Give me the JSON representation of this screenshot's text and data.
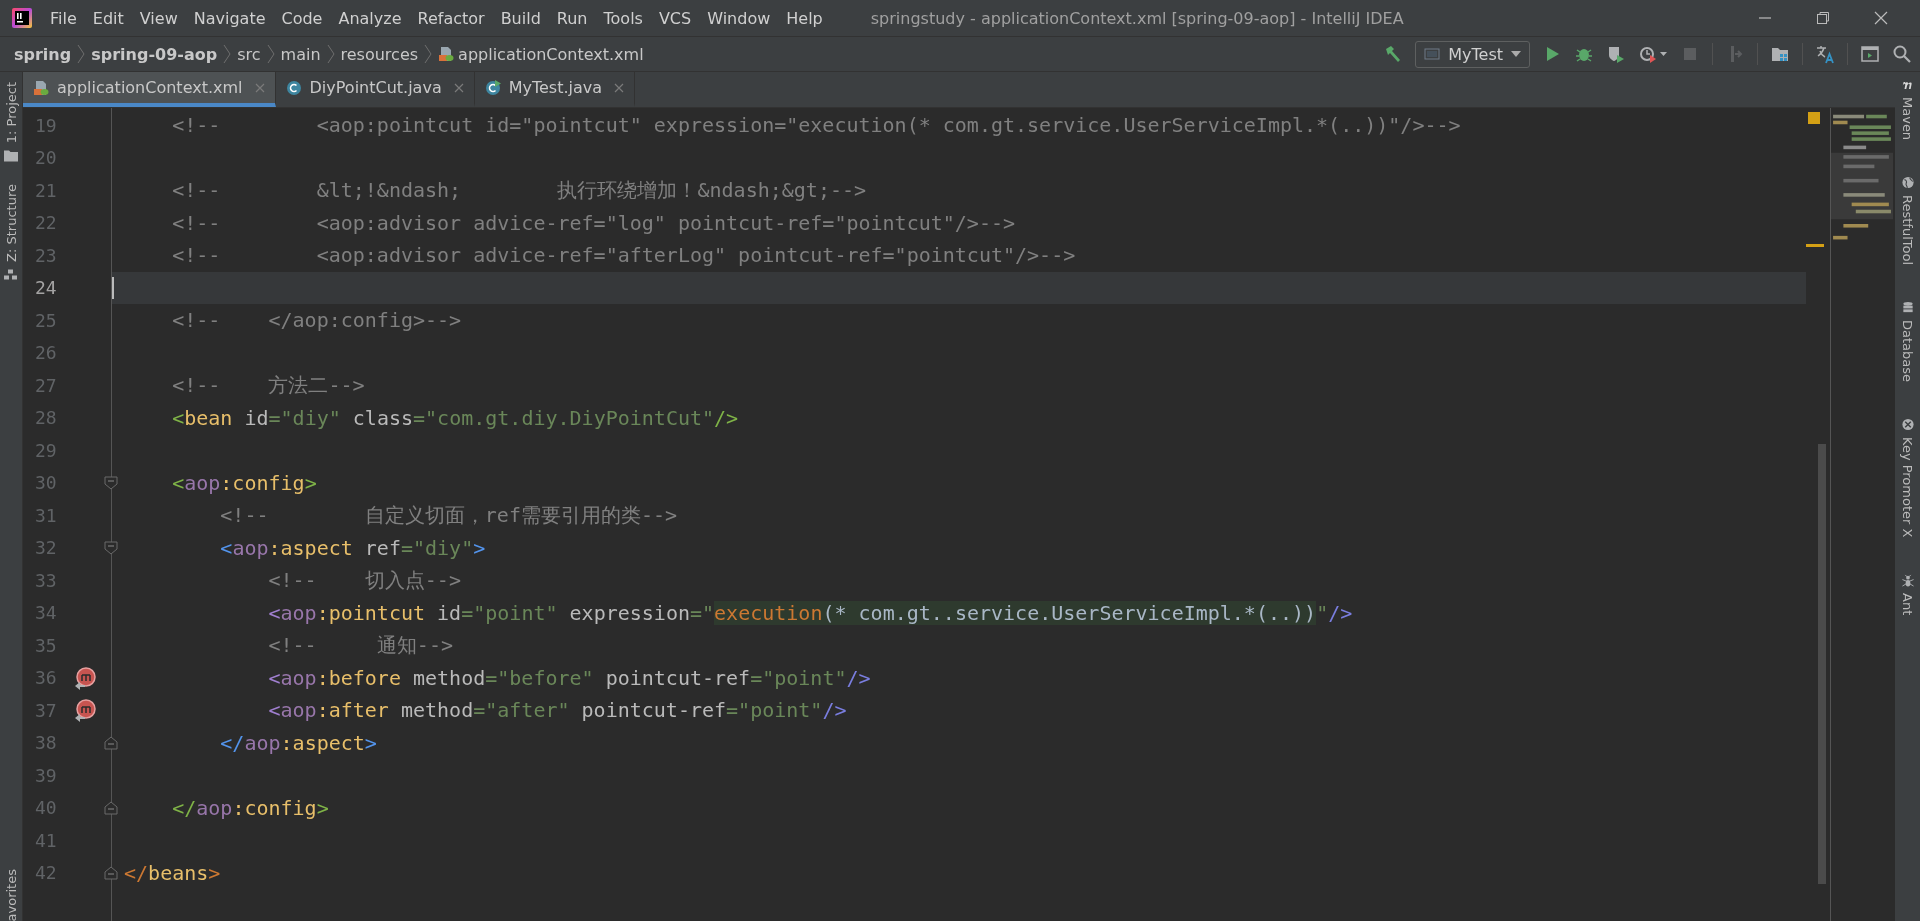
{
  "window": {
    "title": "springstudy - applicationContext.xml [spring-09-aop] - IntelliJ IDEA"
  },
  "menu": [
    "File",
    "Edit",
    "View",
    "Navigate",
    "Code",
    "Analyze",
    "Refactor",
    "Build",
    "Run",
    "Tools",
    "VCS",
    "Window",
    "Help"
  ],
  "breadcrumb": [
    {
      "label": "spring",
      "bold": true,
      "kind": "folder"
    },
    {
      "label": "spring-09-aop",
      "bold": true,
      "kind": "folder"
    },
    {
      "label": "src",
      "bold": false,
      "kind": "folder"
    },
    {
      "label": "main",
      "bold": false,
      "kind": "folder"
    },
    {
      "label": "resources",
      "bold": false,
      "kind": "folder"
    },
    {
      "label": "applicationContext.xml",
      "bold": false,
      "kind": "xml"
    }
  ],
  "toolbar": {
    "run_config": "MyTest"
  },
  "left_stripe": [
    {
      "label": "1: Project",
      "kind": "folder"
    },
    {
      "label": "Z: Structure",
      "kind": "structure"
    }
  ],
  "left_stripe_bottom": "avorites",
  "tabs": [
    {
      "label": "applicationContext.xml",
      "selected": true,
      "kind": "xml"
    },
    {
      "label": "DiyPointCut.java",
      "selected": false,
      "kind": "class"
    },
    {
      "label": "MyTest.java",
      "selected": false,
      "kind": "test"
    }
  ],
  "right_stripe": [
    {
      "label": "Maven",
      "kind": "maven"
    },
    {
      "label": "RestfulTool",
      "kind": "globe"
    },
    {
      "label": "Database",
      "kind": "database"
    },
    {
      "label": "Key Promoter X",
      "kind": "key"
    },
    {
      "label": "Ant",
      "kind": "ant"
    }
  ],
  "lines": [
    {
      "number": "19",
      "current": false,
      "fold_start": false,
      "fold_end": false,
      "override": false,
      "tokens": [
        {
          "kind": "comment",
          "text": "    <!--        <aop:pointcut id=\"pointcut\" expression=\"execution(* com.gt.service.UserServiceImpl.*(..))\"/>-->"
        }
      ]
    },
    {
      "number": "20",
      "current": false,
      "fold_start": false,
      "fold_end": false,
      "override": false
    },
    {
      "number": "21",
      "current": false,
      "fold_start": false,
      "fold_end": false,
      "override": false,
      "tokens": [
        {
          "kind": "comment",
          "text": "    <!--        &lt;!&ndash;        执行环绕增加！&ndash;&gt;-->"
        }
      ]
    },
    {
      "number": "22",
      "current": false,
      "fold_start": false,
      "fold_end": false,
      "override": false,
      "tokens": [
        {
          "kind": "comment",
          "text": "    <!--        <aop:advisor advice-ref=\"log\" pointcut-ref=\"pointcut\"/>-->"
        }
      ]
    },
    {
      "number": "23",
      "current": false,
      "fold_start": false,
      "fold_end": false,
      "override": false,
      "tokens": [
        {
          "kind": "comment",
          "text": "    <!--        <aop:advisor advice-ref=\"afterLog\" pointcut-ref=\"pointcut\"/>-->"
        }
      ]
    },
    {
      "number": "24",
      "current": true,
      "fold_start": false,
      "fold_end": false,
      "override": false
    },
    {
      "number": "25",
      "current": false,
      "fold_start": false,
      "fold_end": false,
      "override": false,
      "tokens": [
        {
          "kind": "comment",
          "text": "    <!--    </aop:config>-->"
        }
      ]
    },
    {
      "number": "26",
      "current": false,
      "fold_start": false,
      "fold_end": false,
      "override": false
    },
    {
      "number": "27",
      "current": false,
      "fold_start": false,
      "fold_end": false,
      "override": false,
      "tokens": [
        {
          "kind": "comment",
          "text": "    <!--    方法二-->"
        }
      ]
    },
    {
      "number": "28",
      "current": false,
      "fold_start": false,
      "fold_end": false,
      "override": false,
      "tokens": [
        {
          "kind": "bracket",
          "color": "#7fb347",
          "text": "    <"
        },
        {
          "kind": "tag",
          "text": "bean "
        },
        {
          "kind": "attribute",
          "text": "id"
        },
        {
          "kind": "value",
          "text": "=\"diy\" "
        },
        {
          "kind": "attribute",
          "text": "class"
        },
        {
          "kind": "value",
          "text": "=\"com.gt.diy.DiyPointCut\""
        },
        {
          "kind": "bracket",
          "color": "#7fb347",
          "text": "/>"
        }
      ]
    },
    {
      "number": "29",
      "current": false,
      "fold_start": false,
      "fold_end": false,
      "override": false
    },
    {
      "number": "30",
      "current": false,
      "fold_start": true,
      "fold_end": false,
      "override": false,
      "tokens": [
        {
          "kind": "bracket",
          "color": "#7fb347",
          "text": "    <"
        },
        {
          "kind": "namespace",
          "text": "aop"
        },
        {
          "kind": "tag",
          "text": ":config"
        },
        {
          "kind": "bracket",
          "color": "#7fb347",
          "text": ">"
        }
      ]
    },
    {
      "number": "31",
      "current": false,
      "fold_start": false,
      "fold_end": false,
      "override": false,
      "tokens": [
        {
          "kind": "comment",
          "text": "        <!--        自定义切面，ref需要引用的类-->"
        }
      ]
    },
    {
      "number": "32",
      "current": false,
      "fold_start": true,
      "fold_end": false,
      "override": false,
      "tokens": [
        {
          "kind": "bracket",
          "color": "#5394ec",
          "text": "        <"
        },
        {
          "kind": "namespace",
          "text": "aop"
        },
        {
          "kind": "tag",
          "text": ":aspect "
        },
        {
          "kind": "attribute",
          "text": "ref"
        },
        {
          "kind": "value",
          "text": "=\"diy\""
        },
        {
          "kind": "bracket",
          "color": "#5394ec",
          "text": ">"
        }
      ]
    },
    {
      "number": "33",
      "current": false,
      "fold_start": false,
      "fold_end": false,
      "override": false,
      "tokens": [
        {
          "kind": "comment",
          "text": "            <!--    切入点-->"
        }
      ]
    },
    {
      "number": "34",
      "current": false,
      "fold_start": false,
      "fold_end": false,
      "override": false,
      "tokens": [
        {
          "kind": "bracket",
          "color": "#a07fd0",
          "text": "            <"
        },
        {
          "kind": "namespace",
          "text": "aop"
        },
        {
          "kind": "tag",
          "text": ":pointcut "
        },
        {
          "kind": "attribute",
          "text": "id"
        },
        {
          "kind": "value",
          "text": "=\"point\" "
        },
        {
          "kind": "attribute",
          "text": "expression"
        },
        {
          "kind": "value",
          "text": "=\""
        },
        {
          "kind": "call",
          "text": "execution"
        },
        {
          "kind": "expression",
          "text": "(* com.gt..service.UserServiceImpl.*(..))"
        },
        {
          "kind": "value",
          "text": "\""
        },
        {
          "kind": "bracket",
          "color": "#7a7ee0",
          "text": "/>"
        }
      ]
    },
    {
      "number": "35",
      "current": false,
      "fold_start": false,
      "fold_end": false,
      "override": false,
      "tokens": [
        {
          "kind": "comment",
          "text": "            <!--     通知-->"
        }
      ]
    },
    {
      "number": "36",
      "current": false,
      "fold_start": false,
      "fold_end": false,
      "override": true,
      "tokens": [
        {
          "kind": "bracket",
          "color": "#a07fd0",
          "text": "            <"
        },
        {
          "kind": "namespace",
          "text": "aop"
        },
        {
          "kind": "tag",
          "text": ":before "
        },
        {
          "kind": "attribute",
          "text": "method"
        },
        {
          "kind": "value",
          "text": "=\"before\" "
        },
        {
          "kind": "attribute",
          "text": "pointcut-ref"
        },
        {
          "kind": "value",
          "text": "=\"point\""
        },
        {
          "kind": "bracket",
          "color": "#7a7ee0",
          "text": "/>"
        }
      ]
    },
    {
      "number": "37",
      "current": false,
      "fold_start": false,
      "fold_end": false,
      "override": true,
      "tokens": [
        {
          "kind": "bracket",
          "color": "#a07fd0",
          "text": "            <"
        },
        {
          "kind": "namespace",
          "text": "aop"
        },
        {
          "kind": "tag",
          "text": ":after "
        },
        {
          "kind": "attribute",
          "text": "method"
        },
        {
          "kind": "value",
          "text": "=\"after\" "
        },
        {
          "kind": "attribute",
          "text": "pointcut-ref"
        },
        {
          "kind": "value",
          "text": "=\"point\""
        },
        {
          "kind": "bracket",
          "color": "#7a7ee0",
          "text": "/>"
        }
      ]
    },
    {
      "number": "38",
      "current": false,
      "fold_start": false,
      "fold_end": true,
      "override": false,
      "tokens": [
        {
          "kind": "bracket",
          "color": "#5394ec",
          "text": "        </"
        },
        {
          "kind": "namespace",
          "text": "aop"
        },
        {
          "kind": "tag",
          "text": ":aspect"
        },
        {
          "kind": "bracket",
          "color": "#5394ec",
          "text": ">"
        }
      ]
    },
    {
      "number": "39",
      "current": false,
      "fold_start": false,
      "fold_end": false,
      "override": false
    },
    {
      "number": "40",
      "current": false,
      "fold_start": false,
      "fold_end": true,
      "override": false,
      "tokens": [
        {
          "kind": "bracket",
          "color": "#7fb347",
          "text": "    </"
        },
        {
          "kind": "namespace",
          "text": "aop"
        },
        {
          "kind": "tag",
          "text": ":config"
        },
        {
          "kind": "bracket",
          "color": "#7fb347",
          "text": ">"
        }
      ]
    },
    {
      "number": "41",
      "current": false,
      "fold_start": false,
      "fold_end": false,
      "override": false
    },
    {
      "number": "42",
      "current": false,
      "fold_start": false,
      "fold_end": true,
      "override": false,
      "tokens": [
        {
          "kind": "bracket",
          "color": "#cc7832",
          "text": "</"
        },
        {
          "kind": "tag",
          "text": "beans"
        },
        {
          "kind": "bracket",
          "color": "#cc7832",
          "text": ">"
        }
      ]
    }
  ]
}
